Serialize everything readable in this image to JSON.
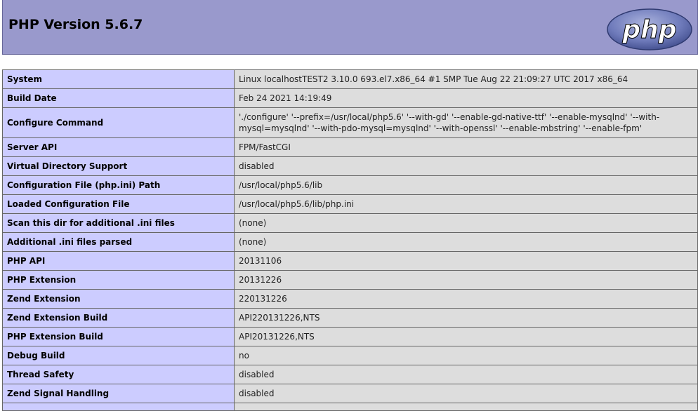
{
  "header": {
    "title": "PHP Version 5.6.7",
    "logo_text": "php"
  },
  "colors": {
    "header_bg": "#9999cc",
    "label_cell_bg": "#ccccff",
    "value_cell_bg": "#dddddd",
    "border": "#666666",
    "logo_bg": "#5c6ba8",
    "logo_text": "#000000"
  },
  "rows": [
    {
      "label": "System",
      "value": "Linux localhostTEST2 3.10.0 693.el7.x86_64 #1 SMP Tue Aug 22 21:09:27 UTC 2017 x86_64"
    },
    {
      "label": "Build Date",
      "value": "Feb 24 2021 14:19:49"
    },
    {
      "label": "Configure Command",
      "value": "'./configure' '--prefix=/usr/local/php5.6' '--with-gd' '--enable-gd-native-ttf' '--enable-mysqlnd' '--with-mysql=mysqlnd' '--with-pdo-mysql=mysqlnd' '--with-openssl' '--enable-mbstring' '--enable-fpm'"
    },
    {
      "label": "Server API",
      "value": "FPM/FastCGI"
    },
    {
      "label": "Virtual Directory Support",
      "value": "disabled"
    },
    {
      "label": "Configuration File (php.ini) Path",
      "value": "/usr/local/php5.6/lib"
    },
    {
      "label": "Loaded Configuration File",
      "value": "/usr/local/php5.6/lib/php.ini"
    },
    {
      "label": "Scan this dir for additional .ini files",
      "value": "(none)"
    },
    {
      "label": "Additional .ini files parsed",
      "value": "(none)"
    },
    {
      "label": "PHP API",
      "value": "20131106"
    },
    {
      "label": "PHP Extension",
      "value": "20131226"
    },
    {
      "label": "Zend Extension",
      "value": "220131226"
    },
    {
      "label": "Zend Extension Build",
      "value": "API220131226,NTS"
    },
    {
      "label": "PHP Extension Build",
      "value": "API20131226,NTS"
    },
    {
      "label": "Debug Build",
      "value": "no"
    },
    {
      "label": "Thread Safety",
      "value": "disabled"
    },
    {
      "label": "Zend Signal Handling",
      "value": "disabled"
    }
  ]
}
